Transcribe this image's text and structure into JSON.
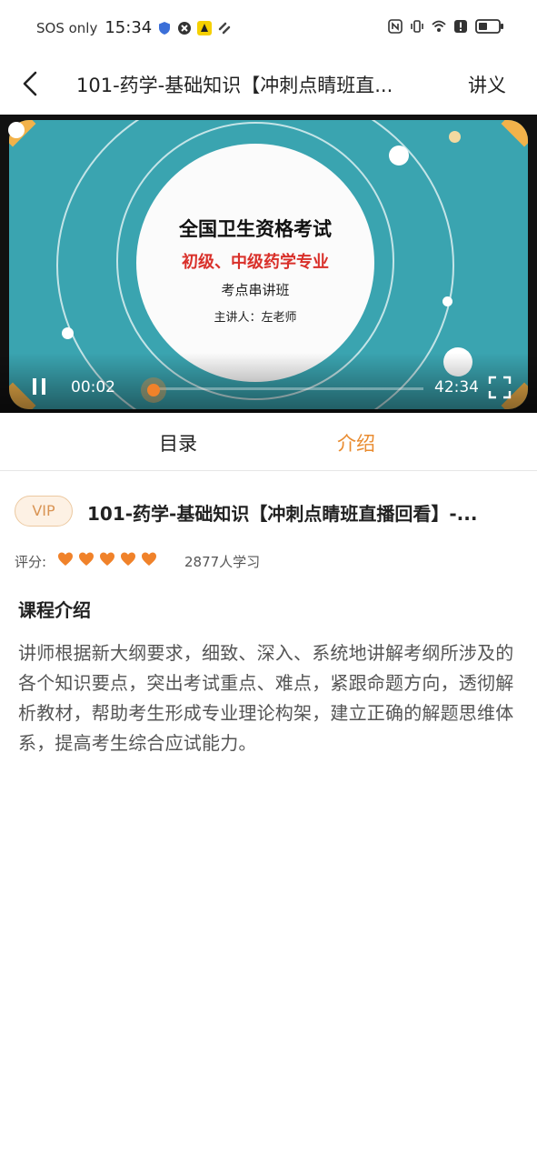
{
  "status_bar": {
    "carrier": "SOS only",
    "time": "15:34",
    "icons_left": [
      "shield-icon",
      "close-circle-icon",
      "app-notification-icon",
      "sync-icon"
    ],
    "icons_right": [
      "nfc-icon",
      "vibrate-icon",
      "wifi-icon",
      "alert-icon",
      "battery-icon"
    ]
  },
  "header": {
    "title": "101-药学-基础知识【冲刺点睛班直...",
    "action_label": "讲义"
  },
  "video": {
    "slide": {
      "heading": "全国卫生资格考试",
      "subheading": "初级、中级药学专业",
      "course_name": "考点串讲班",
      "lecturer": "主讲人：左老师"
    },
    "current_time": "00:02",
    "total_time": "42:34",
    "progress": 0.001
  },
  "tabs": [
    {
      "label": "目录",
      "active": false
    },
    {
      "label": "介绍",
      "active": true
    }
  ],
  "course": {
    "badge": "VIP",
    "title": "101-药学-基础知识【冲刺点睛班直播回看】-...",
    "rating_label": "评分:",
    "rating": 5,
    "learners": "2877人学习",
    "section_title": "课程介绍",
    "description": "讲师根据新大纲要求，细致、深入、系统地讲解考纲所涉及的各个知识要点，突出考试重点、难点，紧跟命题方向，透彻解析教材，帮助考生形成专业理论构架，建立正确的解题思维体系，提高考生综合应试能力。"
  },
  "colors": {
    "accent": "#e98b2f",
    "heart": "#f0822a",
    "slide_bg": "#3aa4b0"
  }
}
